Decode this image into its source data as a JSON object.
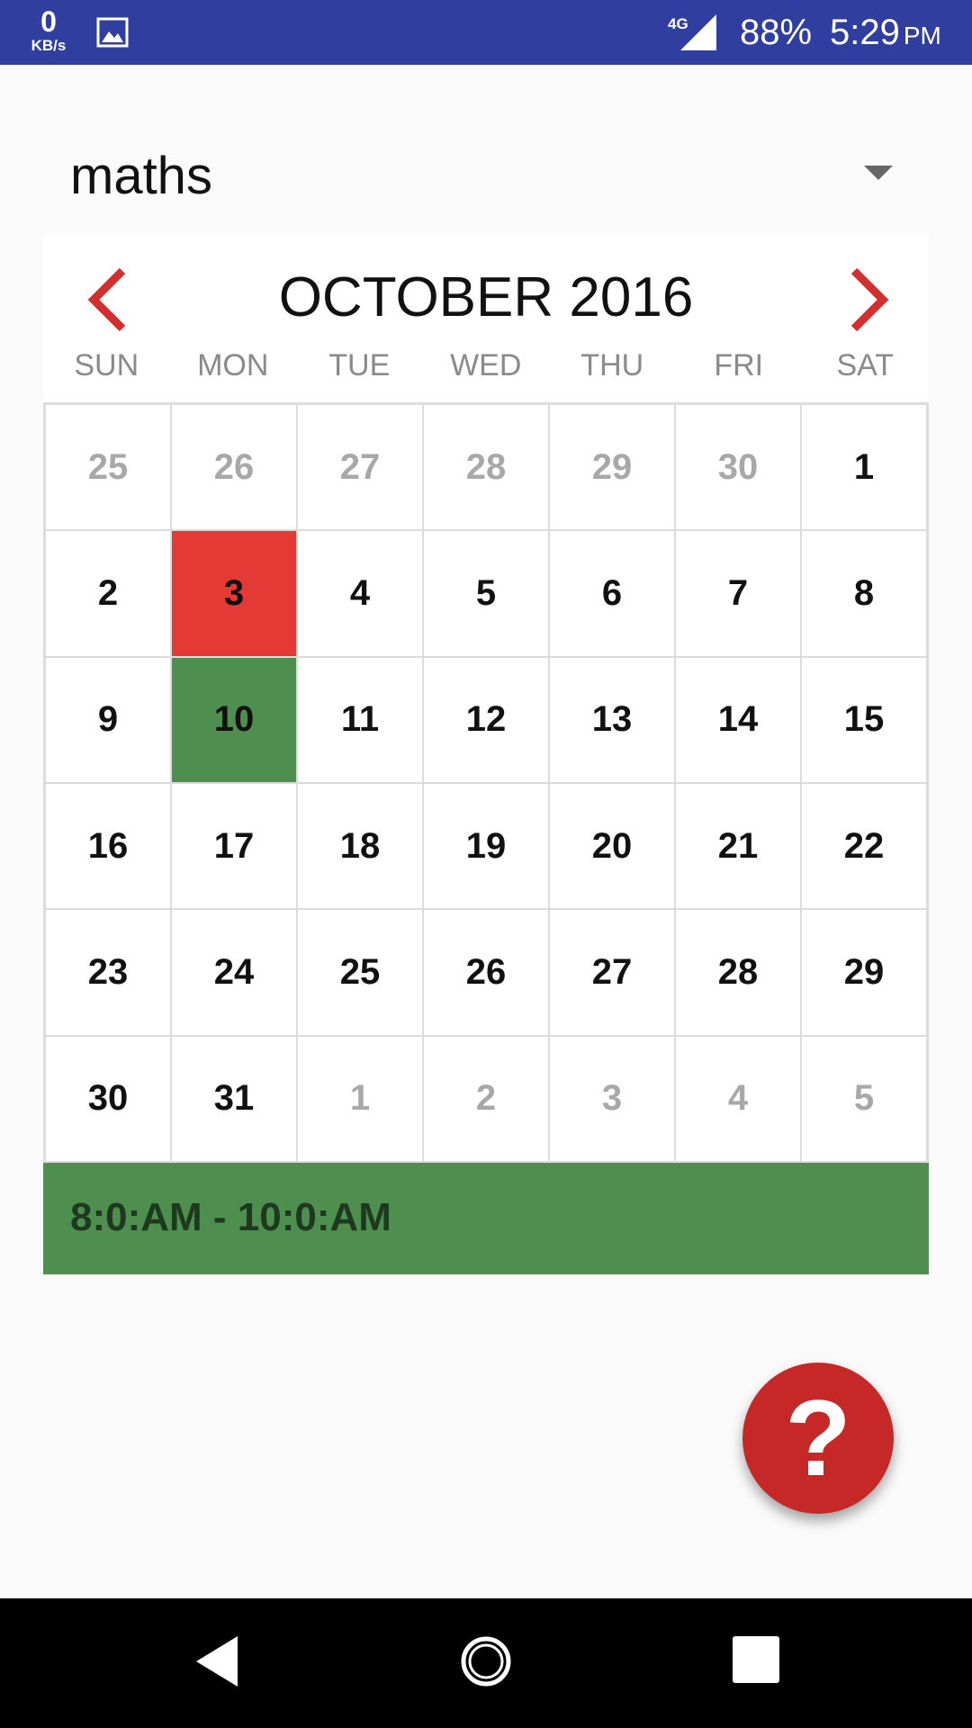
{
  "status_bar": {
    "net_speed": "0",
    "net_unit": "KB/s",
    "network_type": "4G",
    "battery": "88%",
    "time": "5:29",
    "ampm": "PM",
    "icons": [
      "gallery-icon",
      "signal-icon"
    ]
  },
  "subject": {
    "selected": "maths"
  },
  "calendar": {
    "month_title": "OCTOBER 2016",
    "weekdays": [
      "SUN",
      "MON",
      "TUE",
      "WED",
      "THU",
      "FRI",
      "SAT"
    ],
    "days": [
      {
        "label": "25",
        "state": "other"
      },
      {
        "label": "26",
        "state": "other"
      },
      {
        "label": "27",
        "state": "other"
      },
      {
        "label": "28",
        "state": "other"
      },
      {
        "label": "29",
        "state": "other"
      },
      {
        "label": "30",
        "state": "other"
      },
      {
        "label": "1",
        "state": "normal"
      },
      {
        "label": "2",
        "state": "normal"
      },
      {
        "label": "3",
        "state": "red"
      },
      {
        "label": "4",
        "state": "normal"
      },
      {
        "label": "5",
        "state": "normal"
      },
      {
        "label": "6",
        "state": "normal"
      },
      {
        "label": "7",
        "state": "normal"
      },
      {
        "label": "8",
        "state": "normal"
      },
      {
        "label": "9",
        "state": "normal"
      },
      {
        "label": "10",
        "state": "green"
      },
      {
        "label": "11",
        "state": "normal"
      },
      {
        "label": "12",
        "state": "normal"
      },
      {
        "label": "13",
        "state": "normal"
      },
      {
        "label": "14",
        "state": "normal"
      },
      {
        "label": "15",
        "state": "normal"
      },
      {
        "label": "16",
        "state": "normal"
      },
      {
        "label": "17",
        "state": "normal"
      },
      {
        "label": "18",
        "state": "normal"
      },
      {
        "label": "19",
        "state": "normal"
      },
      {
        "label": "20",
        "state": "normal"
      },
      {
        "label": "21",
        "state": "normal"
      },
      {
        "label": "22",
        "state": "normal"
      },
      {
        "label": "23",
        "state": "normal"
      },
      {
        "label": "24",
        "state": "normal"
      },
      {
        "label": "25",
        "state": "normal"
      },
      {
        "label": "26",
        "state": "normal"
      },
      {
        "label": "27",
        "state": "normal"
      },
      {
        "label": "28",
        "state": "normal"
      },
      {
        "label": "29",
        "state": "normal"
      },
      {
        "label": "30",
        "state": "normal"
      },
      {
        "label": "31",
        "state": "normal"
      },
      {
        "label": "1",
        "state": "other"
      },
      {
        "label": "2",
        "state": "other"
      },
      {
        "label": "3",
        "state": "other"
      },
      {
        "label": "4",
        "state": "other"
      },
      {
        "label": "5",
        "state": "other"
      }
    ],
    "colors": {
      "highlight_red": "#e53935",
      "highlight_green": "#4e8f50",
      "nav_arrow": "#d32f2f"
    }
  },
  "schedule": {
    "time_range": "8:0:AM - 10:0:AM"
  },
  "fab": {
    "label": "?",
    "icon": "help-icon",
    "color": "#c62828"
  },
  "navigation": {
    "icons": [
      "back-icon",
      "home-icon",
      "recents-icon"
    ]
  }
}
